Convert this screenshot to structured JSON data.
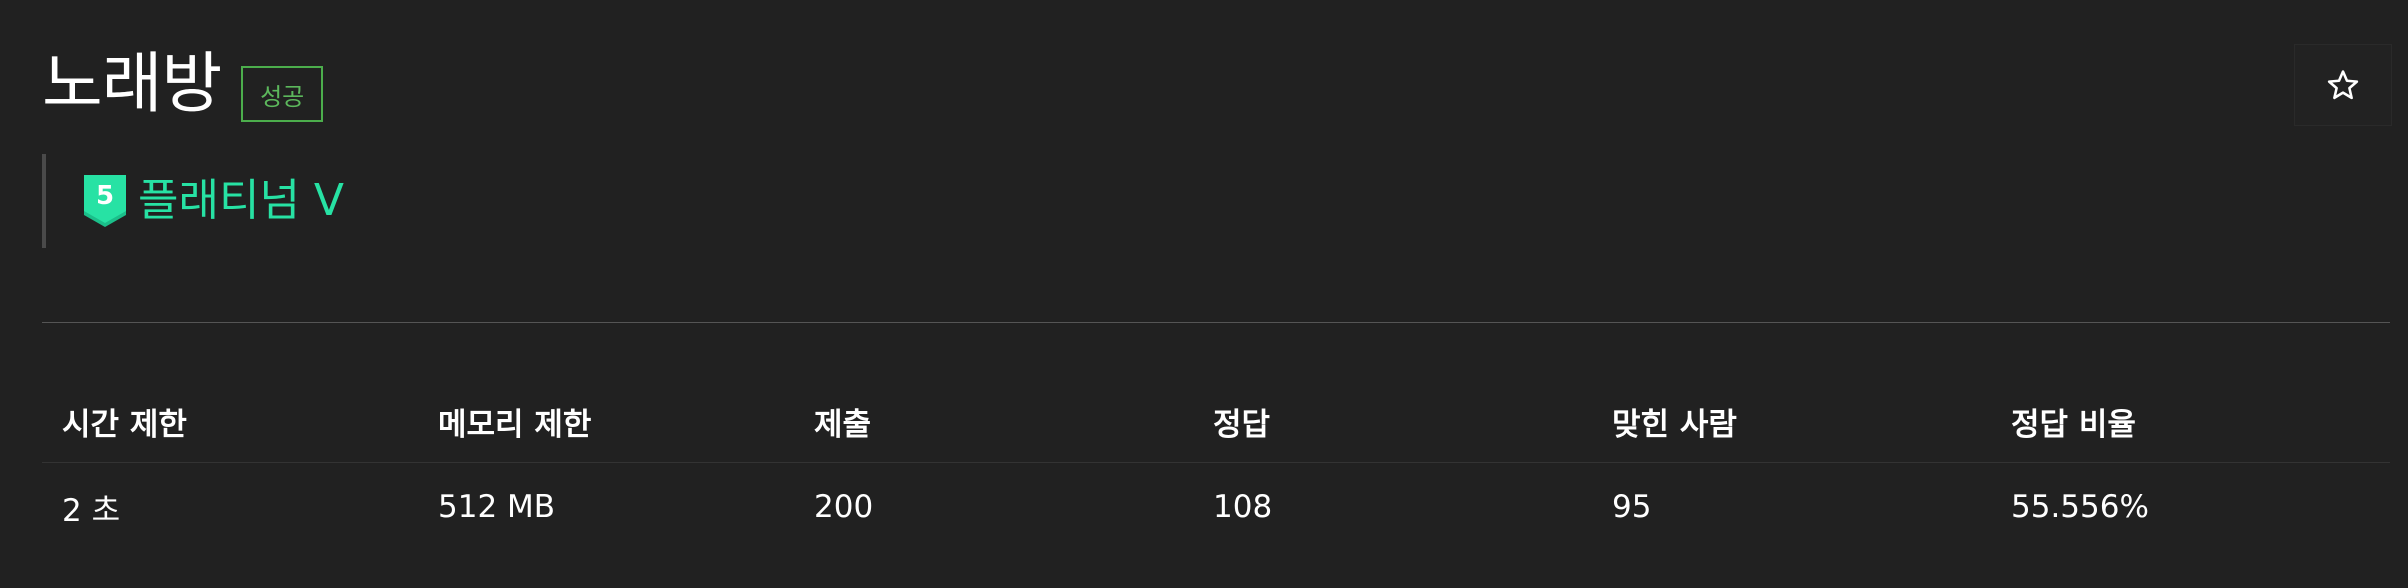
{
  "problem": {
    "title": "노래방",
    "status_badge": "성공",
    "favorite_icon": "star-outline-icon"
  },
  "tier": {
    "icon": "tier-badge-icon",
    "icon_number": "5",
    "label": "플래티넘 V",
    "color": "#27e2a4"
  },
  "stats": {
    "headers": [
      "시간 제한",
      "메모리 제한",
      "제출",
      "정답",
      "맞힌 사람",
      "정답 비율"
    ],
    "values": [
      "2 초",
      "512 MB",
      "200",
      "108",
      "95",
      "55.556%"
    ]
  },
  "colors": {
    "background": "#212121",
    "success": "#5cb85c",
    "platinum": "#27e2a4"
  }
}
